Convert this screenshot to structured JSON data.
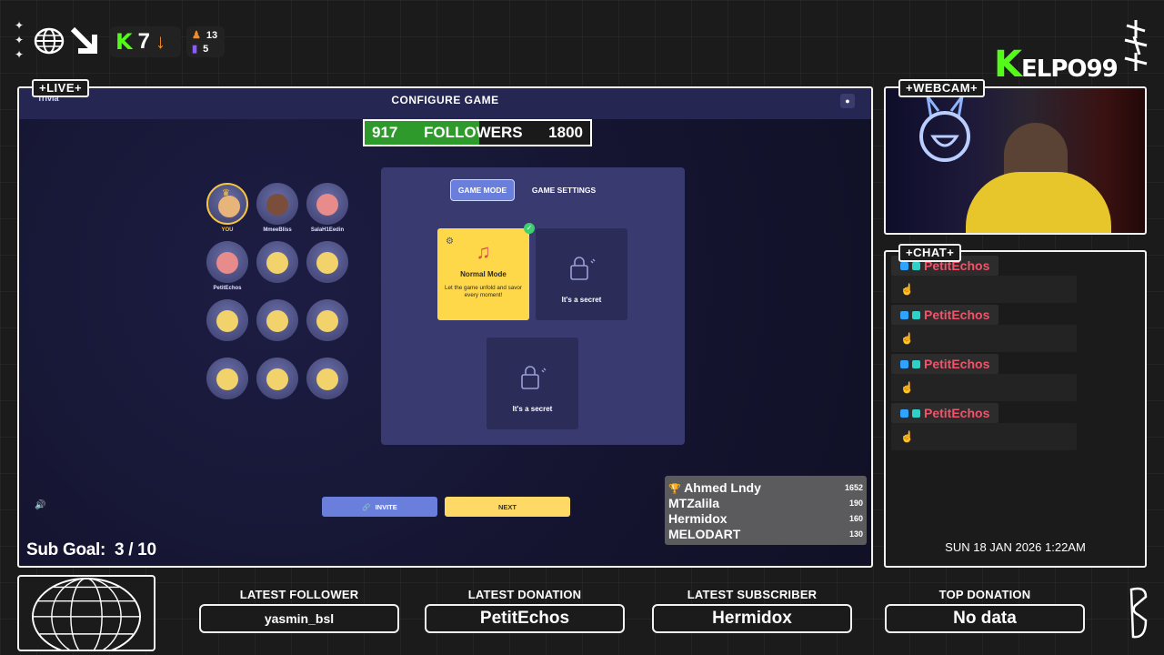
{
  "header": {
    "kick_count": "7",
    "stat_top": "13",
    "stat_bottom": "5",
    "brand_logo": "KELPO99",
    "brand_rest": "ELPO99"
  },
  "panels": {
    "live_tag": "+LIVE+",
    "webcam_tag": "+WEBCAM+",
    "chat_tag": "+CHAT+"
  },
  "game": {
    "title": "CONFIGURE GAME",
    "logo_text": "Trivia",
    "followers": {
      "current": "917",
      "label": "FOLLOWERS",
      "goal": "1800",
      "progress": 0.509
    },
    "players": [
      {
        "name": "YOU"
      },
      {
        "name": "MmeeBliss"
      },
      {
        "name": "SalaH1Eedin"
      },
      {
        "name": "PetitEchos"
      }
    ],
    "tabs": {
      "mode": "GAME MODE",
      "settings": "GAME SETTINGS"
    },
    "cards": {
      "normal_title": "Normal Mode",
      "normal_desc": "Let the game unfold and savor every moment!",
      "secret_1": "It's a secret",
      "secret_2": "It's a secret"
    },
    "invite_label": "INVITE",
    "next_label": "NEXT"
  },
  "leaderboard": [
    {
      "name": "Ahmed Lndy",
      "score": "1652"
    },
    {
      "name": "MTZalila",
      "score": "190"
    },
    {
      "name": "Hermidox",
      "score": "160"
    },
    {
      "name": "MELODART",
      "score": "130"
    }
  ],
  "sub_goal": "Sub Goal:  3 / 10",
  "chat": {
    "messages": [
      {
        "user": "PetitEchos",
        "text": "☝"
      },
      {
        "user": "PetitEchos",
        "text": "☝"
      },
      {
        "user": "PetitEchos",
        "text": "☝"
      },
      {
        "user": "PetitEchos",
        "text": "☝"
      }
    ],
    "date": "SUN 18 JAN 2026 1:22AM"
  },
  "bottom": {
    "latest_follower_title": "LATEST FOLLOWER",
    "latest_follower": "yasmin_bsl",
    "latest_donation_title": "LATEST DONATION",
    "latest_donation": "PetitEchos",
    "latest_subscriber_title": "LATEST SUBSCRIBER",
    "latest_subscriber": "Hermidox",
    "top_donation_title": "TOP DONATION",
    "top_donation": "No data"
  },
  "colors": {
    "kick_green": "#53fc18",
    "accent_blue": "#6a7fdc",
    "next_yellow": "#ffd965",
    "chat_name": "#f0546b"
  },
  "icons": [
    "globe-icon",
    "arrow-icon",
    "kick-icon",
    "down-arrow-icon",
    "gear-icon",
    "lock-icon",
    "link-icon",
    "volume-icon",
    "trophy-icon",
    "close-icon"
  ]
}
